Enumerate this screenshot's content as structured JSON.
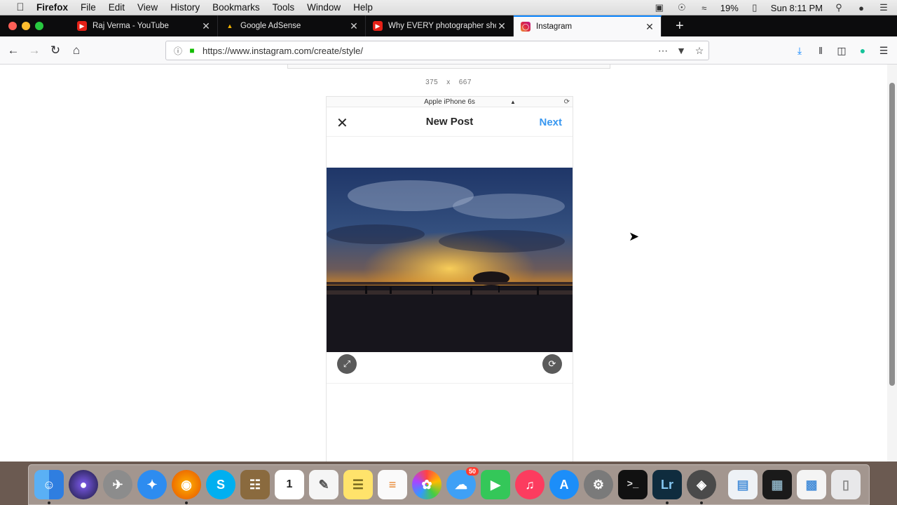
{
  "menubar": {
    "apple_icon": "apple-icon",
    "items": [
      {
        "label": "Firefox",
        "bold": true
      },
      {
        "label": "File"
      },
      {
        "label": "Edit"
      },
      {
        "label": "View"
      },
      {
        "label": "History"
      },
      {
        "label": "Bookmarks"
      },
      {
        "label": "Tools"
      },
      {
        "label": "Window"
      },
      {
        "label": "Help"
      }
    ],
    "battery": "19%",
    "clock": "Sun 8:11 PM"
  },
  "tabs": [
    {
      "title": "Raj Verma - YouTube",
      "favicon": "youtube-icon",
      "active": false
    },
    {
      "title": "Google AdSense",
      "favicon": "adsense-icon",
      "active": false
    },
    {
      "title": "Why EVERY photographer shou",
      "favicon": "youtube-icon",
      "active": false
    },
    {
      "title": "Instagram",
      "favicon": "instagram-icon",
      "active": true
    }
  ],
  "navbar": {
    "url": "https://www.instagram.com/create/style/"
  },
  "rdm": {
    "width": "375",
    "times": "x",
    "height": "667",
    "device": "Apple iPhone 6s"
  },
  "post": {
    "title": "New Post",
    "next": "Next",
    "close_icon": "close-icon"
  },
  "colors": {
    "accent": "#3897f0",
    "tab_active_border": "#0a84ff"
  },
  "dock": {
    "badge_messages": "50",
    "calendar_day": "1"
  }
}
